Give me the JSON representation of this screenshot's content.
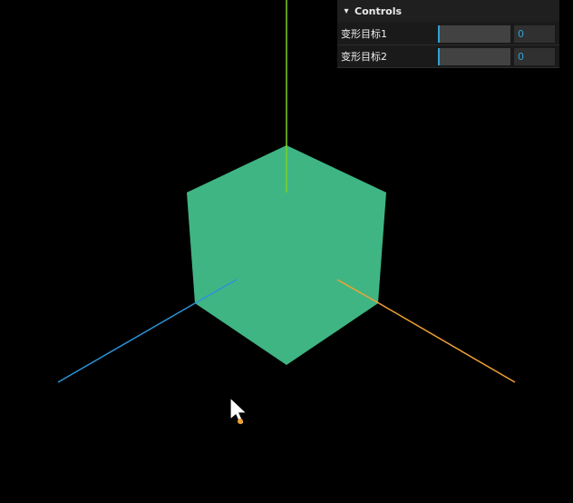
{
  "scene": {
    "background": "#000000",
    "cube_color": "#3fb583",
    "axes": {
      "x_color": "#f0a133",
      "y_color": "#7fd021",
      "z_color": "#2b93d8"
    }
  },
  "gui": {
    "title": "Controls",
    "collapse_icon": "chevron-down-icon",
    "controls": [
      {
        "label": "变形目标1",
        "value": "0",
        "fraction": 0
      },
      {
        "label": "变形目标2",
        "value": "0",
        "fraction": 0
      }
    ]
  },
  "cursor": {
    "icon": "mouse-pointer-icon"
  }
}
